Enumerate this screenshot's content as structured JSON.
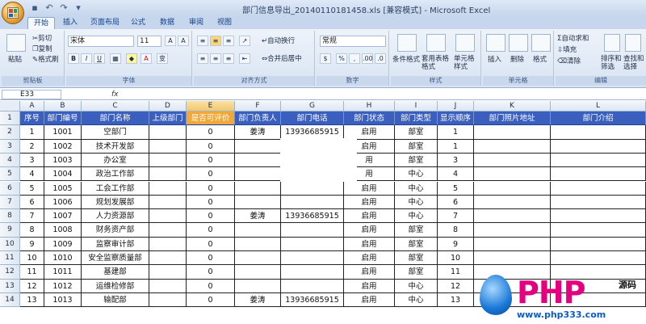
{
  "window": {
    "title": "部门信息导出_20140110181458.xls  [兼容模式] - Microsoft Excel"
  },
  "quick_access": [
    "save-icon",
    "undo-icon",
    "redo-icon",
    "dropdown-icon"
  ],
  "tabs": [
    "开始",
    "插入",
    "页面布局",
    "公式",
    "数据",
    "审阅",
    "视图"
  ],
  "ribbon": {
    "clipboard": {
      "label": "剪贴板",
      "paste": "粘贴",
      "cut": "剪切",
      "copy": "复制",
      "format_painter": "格式刷"
    },
    "font": {
      "label": "字体",
      "font_name": "宋体",
      "font_size": "11",
      "grow": "A",
      "shrink": "A",
      "bold": "B",
      "italic": "I",
      "underline": "U",
      "font_color": "A",
      "phonetic": "变"
    },
    "alignment": {
      "label": "对齐方式",
      "wrap": "自动换行",
      "merge": "合并后居中"
    },
    "number": {
      "label": "数字",
      "format": "常规",
      "percent": "%",
      "comma": ",",
      "increase_decimal": ".00",
      "decrease_decimal": ".0"
    },
    "styles": {
      "label": "样式",
      "cond_format": "条件格式",
      "table_format": "套用表格格式",
      "cell_style": "单元格样式"
    },
    "cells": {
      "label": "单元格",
      "insert": "插入",
      "delete": "删除",
      "format": "格式"
    },
    "editing": {
      "label": "编辑",
      "autosum": "自动求和",
      "fill": "填充",
      "clear": "清除",
      "sort": "排序和筛选",
      "find": "查找和选择"
    }
  },
  "formula_bar": {
    "name_box": "E33",
    "fx": "fx",
    "value": ""
  },
  "columns": [
    "A",
    "B",
    "C",
    "D",
    "E",
    "F",
    "G",
    "H",
    "I",
    "J",
    "K",
    "L"
  ],
  "headers": [
    "序号",
    "部门编号",
    "部门名称",
    "上级部门",
    "是否可评价",
    "部门负责人",
    "部门电话",
    "部门状态",
    "部门类型",
    "显示顺序",
    "部门照片地址",
    "部门介绍"
  ],
  "rows": [
    [
      "1",
      "1001",
      "空部门",
      "",
      "0",
      "姜涛",
      "13936685915",
      "启用",
      "部室",
      "1",
      "",
      ""
    ],
    [
      "2",
      "1002",
      "技术开发部",
      "",
      "0",
      "",
      "",
      "启用",
      "部室",
      "1",
      "",
      ""
    ],
    [
      "3",
      "1003",
      "办公室",
      "",
      "0",
      "",
      "",
      "用",
      "部室",
      "3",
      "",
      ""
    ],
    [
      "4",
      "1004",
      "政治工作部",
      "",
      "0",
      "",
      "",
      "用",
      "中心",
      "4",
      "",
      ""
    ],
    [
      "5",
      "1005",
      "工会工作部",
      "",
      "0",
      "",
      "",
      "启用",
      "中心",
      "5",
      "",
      ""
    ],
    [
      "6",
      "1006",
      "规划发展部",
      "",
      "0",
      "",
      "",
      "启用",
      "中心",
      "6",
      "",
      ""
    ],
    [
      "7",
      "1007",
      "人力资源部",
      "",
      "0",
      "姜涛",
      "13936685915",
      "启用",
      "中心",
      "7",
      "",
      ""
    ],
    [
      "8",
      "1008",
      "财务资产部",
      "",
      "0",
      "",
      "",
      "启用",
      "部室",
      "8",
      "",
      ""
    ],
    [
      "9",
      "1009",
      "监察审计部",
      "",
      "0",
      "",
      "",
      "启用",
      "部室",
      "9",
      "",
      ""
    ],
    [
      "10",
      "1010",
      "安全监察质量部",
      "",
      "0",
      "",
      "",
      "启用",
      "部室",
      "10",
      "",
      ""
    ],
    [
      "11",
      "1011",
      "基建部",
      "",
      "0",
      "",
      "",
      "启用",
      "部室",
      "11",
      "",
      ""
    ],
    [
      "12",
      "1012",
      "运维检修部",
      "",
      "0",
      "",
      "",
      "启用",
      "中心",
      "12",
      "",
      ""
    ],
    [
      "13",
      "1013",
      "输配部",
      "",
      "0",
      "姜涛",
      "13936685915",
      "启用",
      "中心",
      "13",
      "",
      ""
    ]
  ],
  "row_numbers": [
    "1",
    "2",
    "3",
    "4",
    "5",
    "6",
    "7",
    "8",
    "9",
    "10",
    "11",
    "12",
    "13",
    "14"
  ],
  "watermark": {
    "logo": "PHP",
    "suffix": "源码",
    "url": "www.php333.com"
  },
  "colors": {
    "header_bg": "#3a5fbf",
    "selected_header": "#f0a83a",
    "watermark_pink": "#e4007f",
    "watermark_blue": "#0e5bc8"
  }
}
